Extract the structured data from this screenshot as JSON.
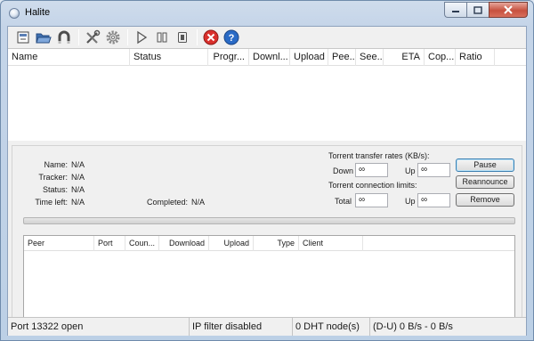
{
  "window": {
    "title": "Halite",
    "icons": {
      "app": "halite-app-icon",
      "minimize": "minimize-icon",
      "maximize": "maximize-icon",
      "close": "close-icon"
    }
  },
  "toolbar": {
    "buttons": [
      {
        "name": "open-torrent-button",
        "icon": "open-torrent-file-icon"
      },
      {
        "name": "open-folder-button",
        "icon": "folder-open-icon"
      },
      {
        "name": "magnet-link-button",
        "icon": "magnet-icon"
      },
      {
        "name": "settings-button",
        "icon": "tools-icon"
      },
      {
        "name": "preferences-button",
        "icon": "gear-icon"
      },
      {
        "name": "resume-button",
        "icon": "play-icon"
      },
      {
        "name": "pause-all-button",
        "icon": "pause-icon"
      },
      {
        "name": "stop-button",
        "icon": "stop-icon"
      },
      {
        "name": "remove-button",
        "icon": "remove-red-icon"
      },
      {
        "name": "help-button",
        "icon": "help-icon"
      }
    ]
  },
  "torrent_list": {
    "columns": [
      "Name",
      "Status",
      "Progr...",
      "Downl...",
      "Upload",
      "Pee...",
      "See...",
      "ETA",
      "Cop...",
      "Ratio"
    ],
    "rows": []
  },
  "details": {
    "fields": [
      {
        "label": "Name:",
        "value": "N/A"
      },
      {
        "label": "Tracker:",
        "value": "N/A"
      },
      {
        "label": "Status:",
        "value": "N/A"
      },
      {
        "label": "Time left:",
        "value": "N/A"
      }
    ],
    "completed": {
      "label": "Completed:",
      "value": "N/A"
    },
    "rates": {
      "heading": "Torrent transfer rates (KB/s):",
      "down_label": "Down",
      "down_value": "∞",
      "up_label": "Up",
      "up_value": "∞"
    },
    "limits": {
      "heading": "Torrent connection limits:",
      "total_label": "Total",
      "total_value": "∞",
      "up_label": "Up",
      "up_value": "∞"
    },
    "buttons": {
      "pause": "Pause",
      "reannounce": "Reannounce",
      "remove": "Remove"
    },
    "progress": 0
  },
  "peer_list": {
    "columns": [
      "Peer",
      "Port",
      "Coun...",
      "Download",
      "Upload",
      "Type",
      "Client"
    ],
    "rows": []
  },
  "statusbar": {
    "port": "Port 13322 open",
    "ipfilter": "IP filter disabled",
    "dht": "0 DHT node(s)",
    "rates": "(D-U) 0 B/s - 0 B/s"
  }
}
